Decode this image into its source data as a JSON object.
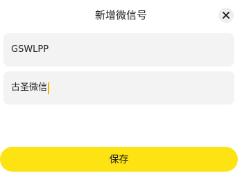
{
  "dialog": {
    "title": "新增微信号",
    "close_icon": "close-icon"
  },
  "form": {
    "fields": [
      {
        "value": "GSWLPP"
      },
      {
        "value": "古圣微信"
      }
    ]
  },
  "actions": {
    "save_label": "保存"
  },
  "colors": {
    "accent": "#fde312",
    "field_bg": "#f3f3f3",
    "caret": "#f0b400"
  }
}
